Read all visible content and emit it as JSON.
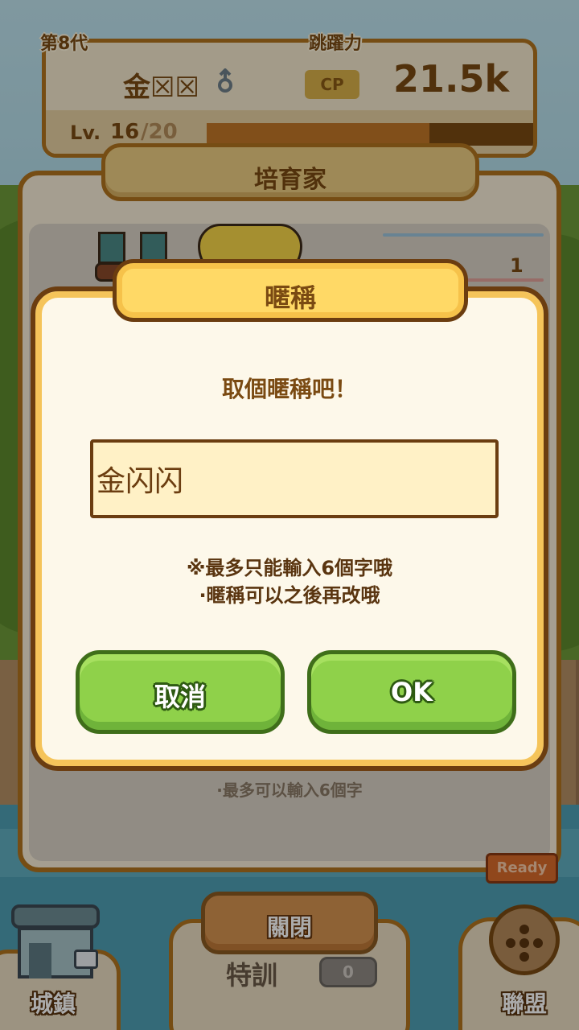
{
  "colors": {
    "panel_border": "#b0741f",
    "dialog_border": "#6b3d10",
    "title_yellow": "#ffd966",
    "button_green": "#8fd14a",
    "text_brown": "#7a4a12"
  },
  "status": {
    "generation": "第8代",
    "jump_power_label": "跳躍力",
    "pokemon_name": "金☒☒",
    "gender_icon": "male-icon",
    "cp_label": "CP",
    "power_value": "21.5k",
    "level_label": "Lv.",
    "level_value": "16",
    "level_max": "/20",
    "xp_progress_fraction": 0.68
  },
  "breeder": {
    "title": "培育家",
    "stat_value": "1",
    "note": "·最多可以輸入6個字"
  },
  "dialog": {
    "title": "暱稱",
    "prompt": "取個暱稱吧！",
    "input_value": "金闪闪",
    "hint_line1": "※最多只能輸入6個字哦",
    "hint_line2": "·暱稱可以之後再改哦",
    "cancel_label": "取消",
    "ok_label": "OK"
  },
  "bottom_nav": {
    "close_label": "關閉",
    "town_label": "城鎮",
    "training_label": "特訓",
    "training_count": "0",
    "alliance_label": "聯盟",
    "ribbon_text": "Ready"
  }
}
